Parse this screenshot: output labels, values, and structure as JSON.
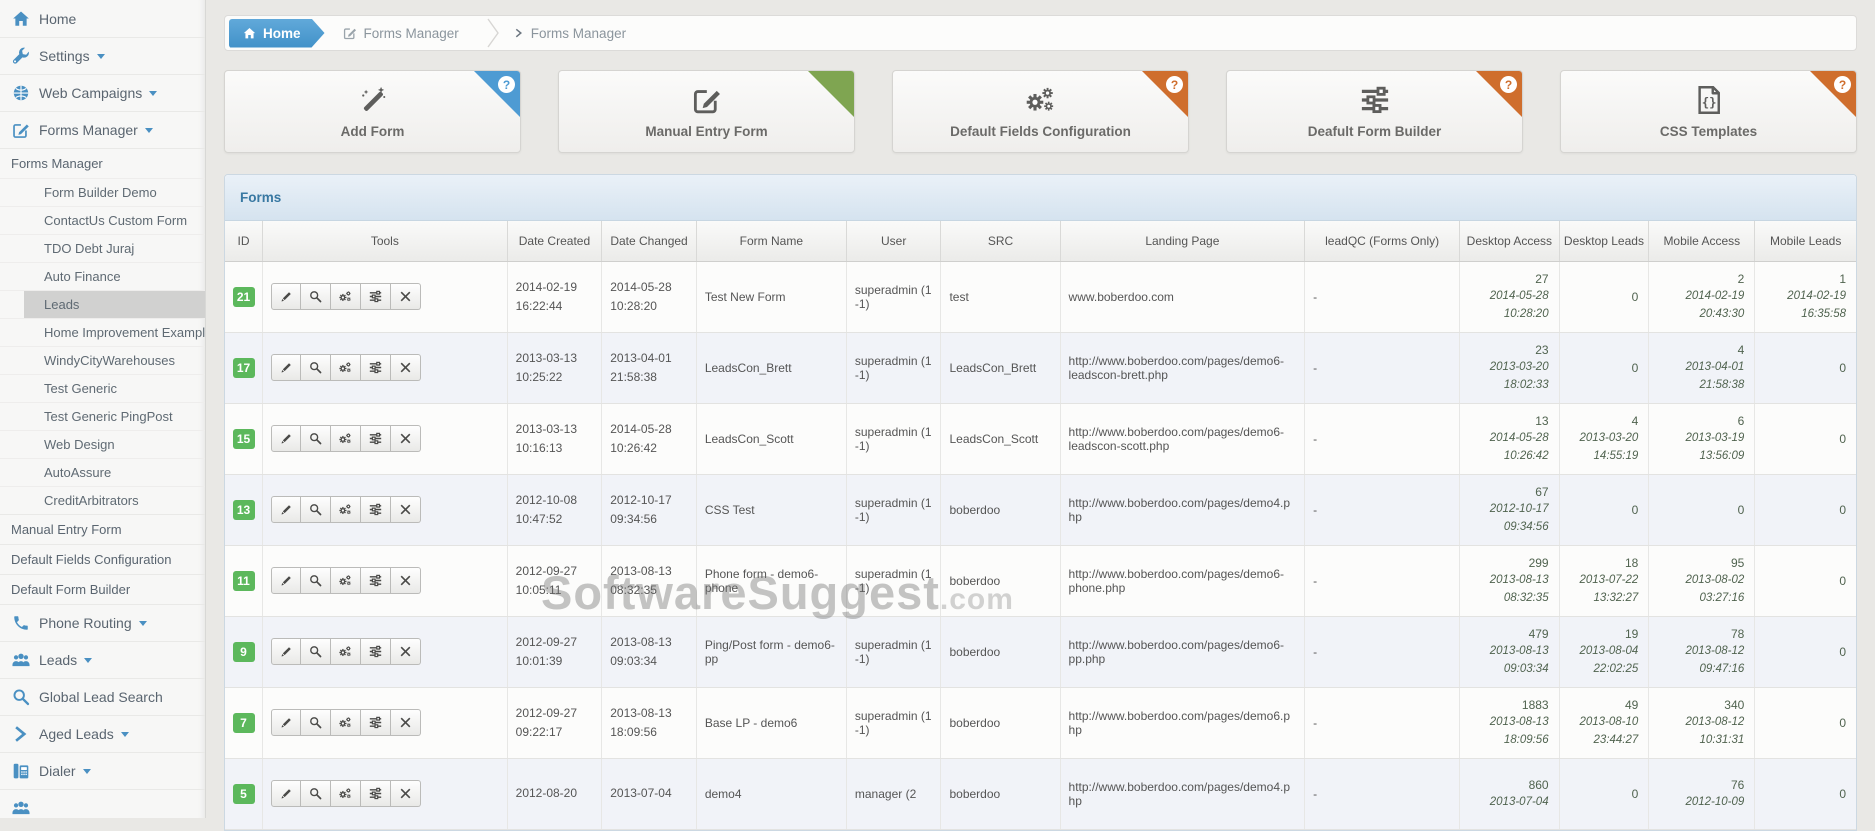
{
  "sidebar": {
    "items": [
      {
        "label": "Home",
        "icon": "home",
        "type": "top"
      },
      {
        "label": "Settings",
        "icon": "wrench",
        "type": "top",
        "caret": true
      },
      {
        "label": "Web Campaigns",
        "icon": "globe",
        "type": "top",
        "caret": true
      },
      {
        "label": "Forms Manager",
        "icon": "edit",
        "type": "top",
        "caret": true,
        "active": true
      },
      {
        "label": "Forms Manager",
        "type": "section"
      },
      {
        "label": "Form Builder Demo",
        "type": "sub"
      },
      {
        "label": "ContactUs Custom Form",
        "type": "sub"
      },
      {
        "label": "TDO Debt Juraj",
        "type": "sub"
      },
      {
        "label": "Auto Finance",
        "type": "sub"
      },
      {
        "label": "Leads",
        "type": "sub",
        "selected": true
      },
      {
        "label": "Home Improvement Example",
        "type": "sub"
      },
      {
        "label": "WindyCityWarehouses",
        "type": "sub"
      },
      {
        "label": "Test Generic",
        "type": "sub"
      },
      {
        "label": "Test Generic PingPost",
        "type": "sub"
      },
      {
        "label": "Web Design",
        "type": "sub"
      },
      {
        "label": "AutoAssure",
        "type": "sub"
      },
      {
        "label": "CreditArbitrators",
        "type": "sub"
      },
      {
        "label": "Manual Entry Form",
        "type": "section"
      },
      {
        "label": "Default Fields Configuration",
        "type": "section"
      },
      {
        "label": "Default Form Builder",
        "type": "section"
      },
      {
        "label": "Phone Routing",
        "icon": "phone",
        "type": "top",
        "caret": true
      },
      {
        "label": "Leads",
        "icon": "users",
        "type": "top",
        "caret": true
      },
      {
        "label": "Global Lead Search",
        "icon": "search",
        "type": "top"
      },
      {
        "label": "Aged Leads",
        "icon": "chev",
        "type": "top",
        "caret": true
      },
      {
        "label": "Dialer",
        "icon": "deskphone",
        "type": "top",
        "caret": true
      },
      {
        "label": "",
        "icon": "users",
        "type": "top"
      }
    ]
  },
  "breadcrumb": {
    "items": [
      {
        "label": "Home"
      },
      {
        "label": "Forms Manager"
      },
      {
        "label": "Forms Manager"
      }
    ]
  },
  "actions": [
    {
      "label": "Add Form",
      "icon": "wand",
      "ribbon": "#4e9bd3",
      "help": true
    },
    {
      "label": "Manual Entry Form",
      "icon": "edit",
      "ribbon": "#7fa551",
      "help": false
    },
    {
      "label": "Default Fields Configuration",
      "icon": "gears",
      "ribbon": "#cf6e2d",
      "help": true
    },
    {
      "label": "Deafult Form Builder",
      "icon": "sliders",
      "ribbon": "#cf6e2d",
      "help": true
    },
    {
      "label": "CSS Templates",
      "icon": "codefile",
      "ribbon": "#cf6e2d",
      "help": true
    }
  ],
  "panel": {
    "title": "Forms"
  },
  "table": {
    "columns": [
      "ID",
      "Tools",
      "Date Created",
      "Date Changed",
      "Form Name",
      "User",
      "SRC",
      "Landing Page",
      "leadQC (Forms Only)",
      "Desktop Access",
      "Desktop Leads",
      "Mobile Access",
      "Mobile Leads"
    ],
    "rows": [
      {
        "id": "21",
        "created_date": "2014-02-19",
        "created_time": "16:22:44",
        "changed_date": "2014-05-28",
        "changed_time": "10:28:20",
        "name": "Test New Form",
        "user": "superadmin (1 -1)",
        "src": "test",
        "landing": "www.boberdoo.com",
        "leadqc": "-",
        "da_n": "27",
        "da_d": "2014-05-28",
        "da_t": "10:28:20",
        "dl_n": "0",
        "dl_d": "",
        "dl_t": "",
        "ma_n": "2",
        "ma_d": "2014-02-19",
        "ma_t": "20:43:30",
        "ml_n": "1",
        "ml_d": "2014-02-19",
        "ml_t": "16:35:58"
      },
      {
        "id": "17",
        "created_date": "2013-03-13",
        "created_time": "10:25:22",
        "changed_date": "2013-04-01",
        "changed_time": "21:58:38",
        "name": "LeadsCon_Brett",
        "user": "superadmin (1 -1)",
        "src": "LeadsCon_Brett",
        "landing": "http://www.boberdoo.com/pages/demo6-leadscon-brett.php",
        "leadqc": "-",
        "da_n": "23",
        "da_d": "2013-03-20",
        "da_t": "18:02:33",
        "dl_n": "0",
        "dl_d": "",
        "dl_t": "",
        "ma_n": "4",
        "ma_d": "2013-04-01",
        "ma_t": "21:58:38",
        "ml_n": "0",
        "ml_d": "",
        "ml_t": ""
      },
      {
        "id": "15",
        "created_date": "2013-03-13",
        "created_time": "10:16:13",
        "changed_date": "2014-05-28",
        "changed_time": "10:26:42",
        "name": "LeadsCon_Scott",
        "user": "superadmin (1 -1)",
        "src": "LeadsCon_Scott",
        "landing": "http://www.boberdoo.com/pages/demo6-leadscon-scott.php",
        "leadqc": "-",
        "da_n": "13",
        "da_d": "2014-05-28",
        "da_t": "10:26:42",
        "dl_n": "4",
        "dl_d": "2013-03-20",
        "dl_t": "14:55:19",
        "ma_n": "6",
        "ma_d": "2013-03-19",
        "ma_t": "13:56:09",
        "ml_n": "0",
        "ml_d": "",
        "ml_t": ""
      },
      {
        "id": "13",
        "created_date": "2012-10-08",
        "created_time": "10:47:52",
        "changed_date": "2012-10-17",
        "changed_time": "09:34:56",
        "name": "CSS Test",
        "user": "superadmin (1 -1)",
        "src": "boberdoo",
        "landing": "http://www.boberdoo.com/pages/demo4.php",
        "leadqc": "-",
        "da_n": "67",
        "da_d": "2012-10-17",
        "da_t": "09:34:56",
        "dl_n": "0",
        "dl_d": "",
        "dl_t": "",
        "ma_n": "0",
        "ma_d": "",
        "ma_t": "",
        "ml_n": "0",
        "ml_d": "",
        "ml_t": ""
      },
      {
        "id": "11",
        "created_date": "2012-09-27",
        "created_time": "10:05:11",
        "changed_date": "2013-08-13",
        "changed_time": "08:32:35",
        "name": "Phone form - demo6-phone",
        "user": "superadmin (1 -1)",
        "src": "boberdoo",
        "landing": "http://www.boberdoo.com/pages/demo6-phone.php",
        "leadqc": "-",
        "da_n": "299",
        "da_d": "2013-08-13",
        "da_t": "08:32:35",
        "dl_n": "18",
        "dl_d": "2013-07-22",
        "dl_t": "13:32:27",
        "ma_n": "95",
        "ma_d": "2013-08-02",
        "ma_t": "03:27:16",
        "ml_n": "0",
        "ml_d": "",
        "ml_t": ""
      },
      {
        "id": "9",
        "created_date": "2012-09-27",
        "created_time": "10:01:39",
        "changed_date": "2013-08-13",
        "changed_time": "09:03:34",
        "name": "Ping/Post form - demo6-pp",
        "user": "superadmin (1 -1)",
        "src": "boberdoo",
        "landing": "http://www.boberdoo.com/pages/demo6-pp.php",
        "leadqc": "-",
        "da_n": "479",
        "da_d": "2013-08-13",
        "da_t": "09:03:34",
        "dl_n": "19",
        "dl_d": "2013-08-04",
        "dl_t": "22:02:25",
        "ma_n": "78",
        "ma_d": "2013-08-12",
        "ma_t": "09:47:16",
        "ml_n": "0",
        "ml_d": "",
        "ml_t": ""
      },
      {
        "id": "7",
        "created_date": "2012-09-27",
        "created_time": "09:22:17",
        "changed_date": "2013-08-13",
        "changed_time": "18:09:56",
        "name": "Base LP - demo6",
        "user": "superadmin (1 -1)",
        "src": "boberdoo",
        "landing": "http://www.boberdoo.com/pages/demo6.php",
        "leadqc": "-",
        "da_n": "1883",
        "da_d": "2013-08-13",
        "da_t": "18:09:56",
        "dl_n": "49",
        "dl_d": "2013-08-10",
        "dl_t": "23:44:27",
        "ma_n": "340",
        "ma_d": "2013-08-12",
        "ma_t": "10:31:31",
        "ml_n": "0",
        "ml_d": "",
        "ml_t": ""
      },
      {
        "id": "5",
        "created_date": "2012-08-20",
        "created_time": "",
        "changed_date": "2013-07-04",
        "changed_time": "",
        "name": "demo4",
        "user": "manager (2",
        "src": "boberdoo",
        "landing": "http://www.boberdoo.com/pages/demo4.php",
        "leadqc": "-",
        "da_n": "860",
        "da_d": "2013-07-04",
        "da_t": "",
        "dl_n": "0",
        "dl_d": "",
        "dl_t": "",
        "ma_n": "76",
        "ma_d": "2012-10-09",
        "ma_t": "",
        "ml_n": "0",
        "ml_d": "",
        "ml_t": ""
      }
    ]
  },
  "watermark": {
    "main": "SoftwareSuggest",
    "suffix": ".com"
  }
}
